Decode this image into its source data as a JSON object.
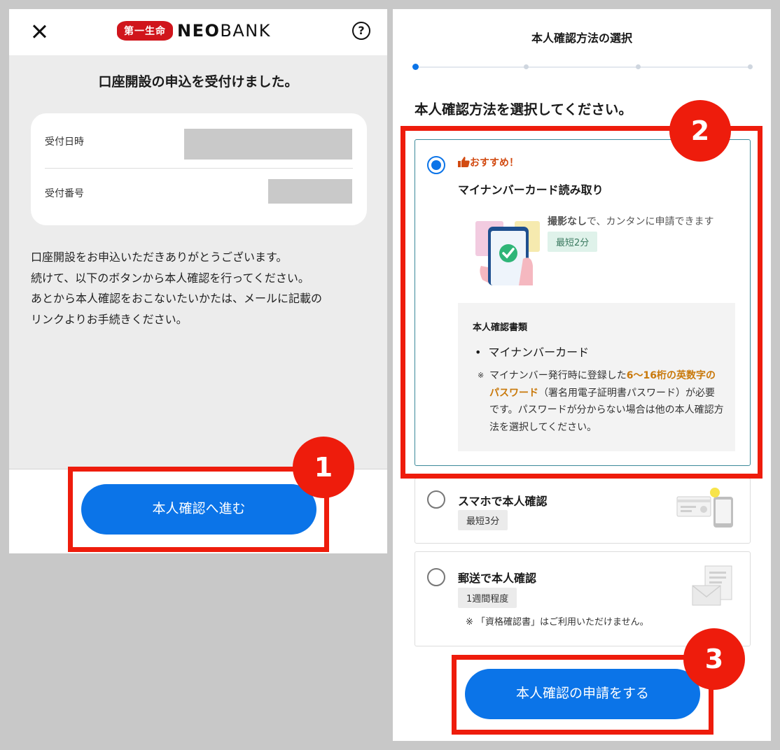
{
  "left": {
    "logo_seal": "第一生命",
    "logo_bold": "NEO",
    "logo_light": "BANK",
    "help_label": "?",
    "title": "口座開設の申込を受付けました。",
    "receipt": [
      {
        "label": "受付日時"
      },
      {
        "label": "受付番号"
      }
    ],
    "body_lines": [
      "口座開設をお申込いただきありがとうございます。",
      "続けて、以下のボタンから本人確認を行ってください。",
      "あとから本人確認をおこないたいかたは、メールに記載の",
      "リンクよりお手続きください。"
    ],
    "cta_label": "本人確認へ進む"
  },
  "right": {
    "header_title": "本人確認方法の選択",
    "progress": {
      "current_step": 1,
      "total_steps": 4
    },
    "heading": "本人確認方法を選択してください。",
    "options": [
      {
        "selected": true,
        "recommend": "おすすめ！",
        "title": "マイナンバーカード読み取り",
        "feature_bold": "撮影なし",
        "feature_rest": "で、カンタンに申請できます",
        "time_tag": "最短2分",
        "docs_title": "本人確認書類",
        "docs_item": "マイナンバーカード",
        "note_mark": "※",
        "note_pre": "マイナンバー発行時に登録した",
        "note_highlight": "6〜16桁の英数字のパスワード",
        "note_post": "（署名用電子証明書パスワード）が必要です。パスワードが分からない場合は他の本人確認方法を選択してください。"
      },
      {
        "selected": false,
        "title": "スマホで本人確認",
        "time_tag": "最短3分"
      },
      {
        "selected": false,
        "title": "郵送で本人確認",
        "time_tag": "1週間程度",
        "note": "※ 「資格確認書」はご利用いただけません。"
      }
    ],
    "cta_label": "本人確認の申請をする"
  },
  "annotations": [
    "1",
    "2",
    "3"
  ],
  "colors": {
    "primary_blue": "#0b74e8",
    "highlight_red": "#ee1c0c",
    "brand_red": "#d0151c",
    "recommend_orange": "#d24b12",
    "password_orange": "#c9790b",
    "tag_teal_bg": "#dff2ea"
  },
  "icons": {
    "close": "close-icon",
    "help": "help-icon",
    "thumbs_up": "thumbs-up-icon",
    "check_phone": "phone-check-illustration",
    "id_phone": "id-card-phone-icon",
    "mail": "mail-document-icon"
  }
}
